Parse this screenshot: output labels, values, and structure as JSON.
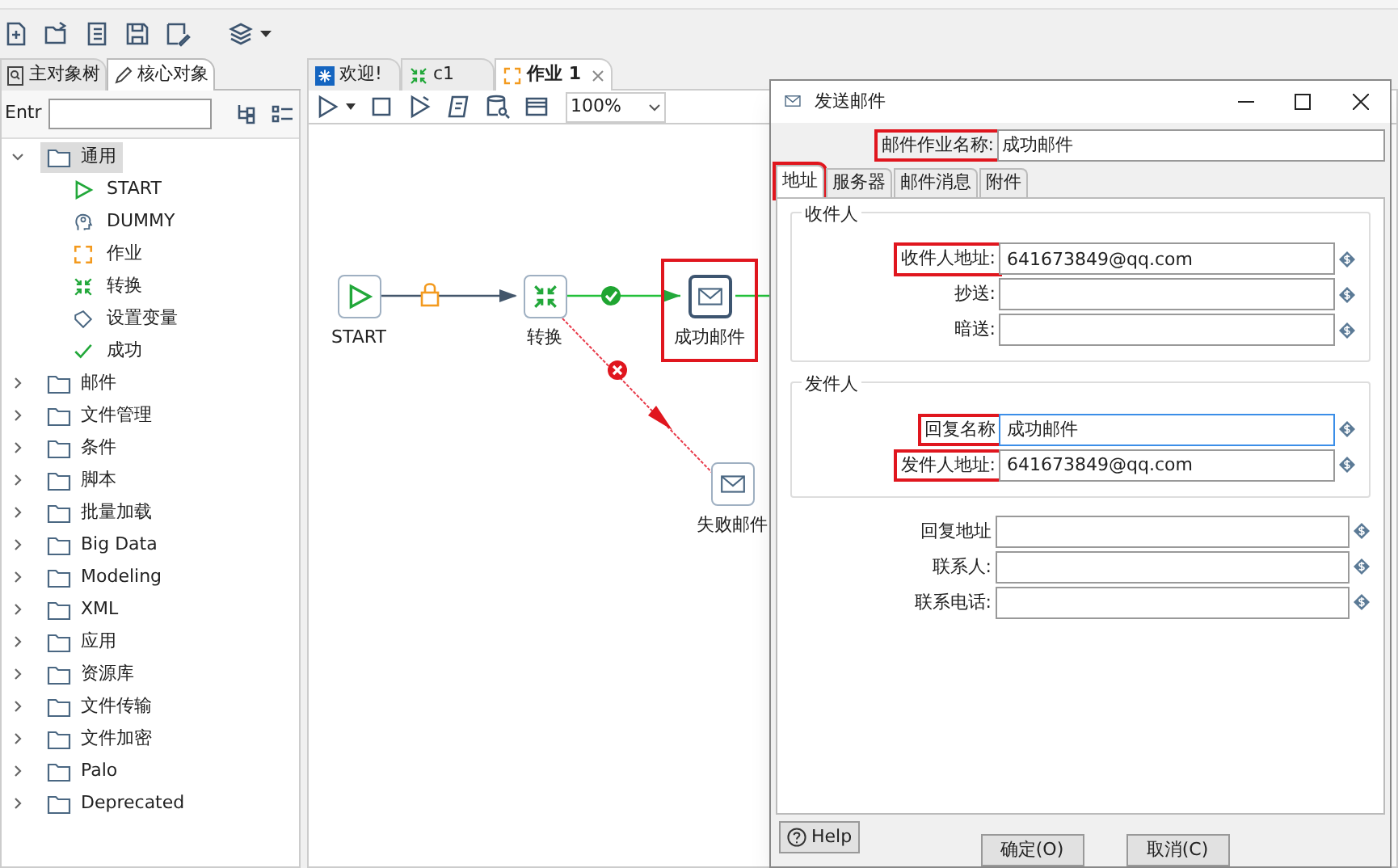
{
  "left_panel": {
    "tabs": [
      {
        "label": "主对象树",
        "selected": false
      },
      {
        "label": "核心对象",
        "selected": true
      }
    ],
    "search_label": "Entr",
    "tree": [
      {
        "label": "通用",
        "expanded": true,
        "selected": true,
        "children": [
          {
            "label": "START",
            "kind": "start"
          },
          {
            "label": "DUMMY",
            "kind": "dummy"
          },
          {
            "label": "作业",
            "kind": "job"
          },
          {
            "label": "转换",
            "kind": "transform"
          },
          {
            "label": "设置变量",
            "kind": "variable"
          },
          {
            "label": "成功",
            "kind": "success"
          }
        ]
      },
      {
        "label": "邮件",
        "expanded": false,
        "selected": false
      },
      {
        "label": "文件管理",
        "expanded": false,
        "selected": false
      },
      {
        "label": "条件",
        "expanded": false,
        "selected": false
      },
      {
        "label": "脚本",
        "expanded": false,
        "selected": false
      },
      {
        "label": "批量加载",
        "expanded": false,
        "selected": false
      },
      {
        "label": "Big Data",
        "expanded": false,
        "selected": false
      },
      {
        "label": "Modeling",
        "expanded": false,
        "selected": false
      },
      {
        "label": "XML",
        "expanded": false,
        "selected": false
      },
      {
        "label": "应用",
        "expanded": false,
        "selected": false
      },
      {
        "label": "资源库",
        "expanded": false,
        "selected": false
      },
      {
        "label": "文件传输",
        "expanded": false,
        "selected": false
      },
      {
        "label": "文件加密",
        "expanded": false,
        "selected": false
      },
      {
        "label": "Palo",
        "expanded": false,
        "selected": false
      },
      {
        "label": "Deprecated",
        "expanded": false,
        "selected": false
      }
    ]
  },
  "editor_tabs": [
    {
      "label": "欢迎!",
      "kind": "welcome",
      "selected": false
    },
    {
      "label": "c1",
      "kind": "transform",
      "selected": false
    },
    {
      "label": "作业 1",
      "kind": "job",
      "selected": true
    }
  ],
  "zoom": "100%",
  "canvas": {
    "nodes": [
      {
        "label": "START",
        "kind": "start",
        "highlighted": false
      },
      {
        "label": "转换",
        "kind": "transform",
        "highlighted": false
      },
      {
        "label": "成功邮件",
        "kind": "mail",
        "highlighted": true
      },
      {
        "label": "失败邮件",
        "kind": "mail",
        "highlighted": false
      }
    ]
  },
  "dialog": {
    "title": "发送邮件",
    "name_label": "邮件作业名称:",
    "name_highlighted": true,
    "name_value": "成功邮件",
    "tabs": [
      {
        "label": "地址",
        "selected": true,
        "highlighted": true
      },
      {
        "label": "服务器",
        "selected": false,
        "highlighted": false
      },
      {
        "label": "邮件消息",
        "selected": false,
        "highlighted": false
      },
      {
        "label": "附件",
        "selected": false,
        "highlighted": false
      }
    ],
    "recipient_group": {
      "title": "收件人",
      "fields": [
        {
          "label": "收件人地址:",
          "value": "641673849@qq.com",
          "highlighted": true,
          "focused": false
        },
        {
          "label": "抄送:",
          "highlighted": false,
          "focused": false
        },
        {
          "label": "暗送:",
          "highlighted": false,
          "focused": false
        }
      ]
    },
    "sender_group": {
      "title": "发件人",
      "fields": [
        {
          "label": "回复名称",
          "value": "成功邮件",
          "highlighted": true,
          "focused": true
        },
        {
          "label": "发件人地址:",
          "value": "641673849@qq.com",
          "highlighted": true,
          "focused": false
        }
      ]
    },
    "extra_fields": [
      {
        "label": "回复地址"
      },
      {
        "label": "联系人:"
      },
      {
        "label": "联系电话:"
      }
    ],
    "buttons": [
      "确定(O)",
      "取消(C)"
    ],
    "help": "Help"
  }
}
